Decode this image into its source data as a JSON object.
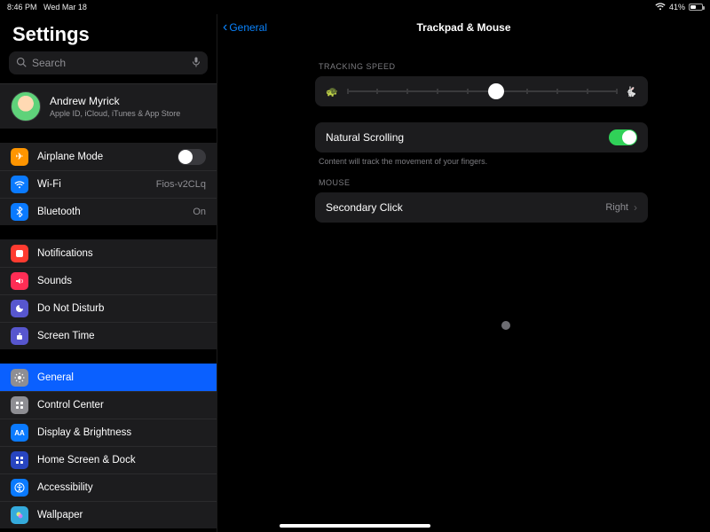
{
  "statusbar": {
    "time": "8:46 PM",
    "date": "Wed Mar 18",
    "battery_pct": "41%",
    "battery_fill": 41
  },
  "sidebar": {
    "title": "Settings",
    "search_placeholder": "Search",
    "profile": {
      "name": "Andrew Myrick",
      "subtitle": "Apple ID, iCloud, iTunes & App Store"
    },
    "group1": [
      {
        "icon": "airplane",
        "color": "#ff9500",
        "label": "Airplane Mode",
        "toggle": false
      },
      {
        "icon": "wifi",
        "color": "#0a7aff",
        "label": "Wi-Fi",
        "value": "Fios-v2CLq"
      },
      {
        "icon": "bluetooth",
        "color": "#0a7aff",
        "label": "Bluetooth",
        "value": "On"
      }
    ],
    "group2": [
      {
        "icon": "notifications",
        "color": "#ff3b30",
        "label": "Notifications"
      },
      {
        "icon": "sounds",
        "color": "#ff2d55",
        "label": "Sounds"
      },
      {
        "icon": "dnd",
        "color": "#5756ce",
        "label": "Do Not Disturb"
      },
      {
        "icon": "screentime",
        "color": "#5756ce",
        "label": "Screen Time"
      }
    ],
    "group3": [
      {
        "icon": "general",
        "color": "#8e8e93",
        "label": "General",
        "selected": true
      },
      {
        "icon": "controlcenter",
        "color": "#8e8e93",
        "label": "Control Center"
      },
      {
        "icon": "display",
        "color": "#0a7aff",
        "label": "Display & Brightness"
      },
      {
        "icon": "homescreen",
        "color": "#2845c0",
        "label": "Home Screen & Dock"
      },
      {
        "icon": "accessibility",
        "color": "#0a7aff",
        "label": "Accessibility"
      },
      {
        "icon": "wallpaper",
        "color": "#34aadc",
        "label": "Wallpaper"
      }
    ]
  },
  "detail": {
    "back_label": "General",
    "title": "Trackpad & Mouse",
    "tracking_header": "TRACKING SPEED",
    "slider": {
      "ticks": 10,
      "value": 5
    },
    "natural_scrolling": {
      "label": "Natural Scrolling",
      "on": true,
      "hint": "Content will track the movement of your fingers."
    },
    "mouse_header": "MOUSE",
    "secondary_click": {
      "label": "Secondary Click",
      "value": "Right"
    }
  },
  "colors": {
    "accent": "#0a84ff",
    "green": "#30d158"
  }
}
